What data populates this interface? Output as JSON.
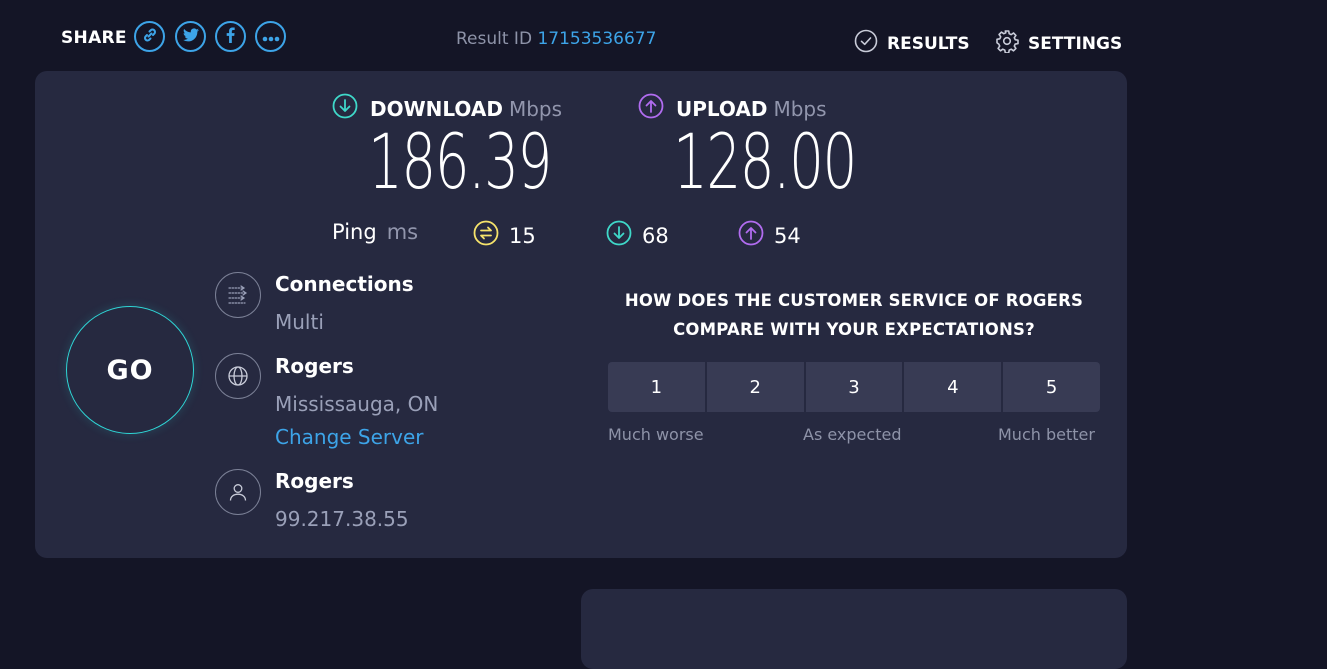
{
  "header": {
    "share_label": "SHARE",
    "share_icons": [
      "link-icon",
      "twitter-icon",
      "facebook-icon",
      "more-icon"
    ],
    "result_id_label": "Result ID",
    "result_id_value": "17153536677",
    "results_label": "RESULTS",
    "settings_label": "SETTINGS"
  },
  "download": {
    "label": "DOWNLOAD",
    "unit": "Mbps",
    "value": "186.39",
    "color": "#3fd8c9"
  },
  "upload": {
    "label": "UPLOAD",
    "unit": "Mbps",
    "value": "128.00",
    "color": "#b16cf0"
  },
  "ping": {
    "label": "Ping",
    "unit": "ms",
    "idle": "15",
    "download": "68",
    "upload": "54",
    "idle_color": "#f6e36b"
  },
  "go_label": "GO",
  "connections": {
    "title": "Connections",
    "value": "Multi"
  },
  "server": {
    "title": "Rogers",
    "location": "Mississauga, ON",
    "change_label": "Change Server"
  },
  "provider": {
    "title": "Rogers",
    "ip": "99.217.38.55"
  },
  "survey": {
    "question_line1": "HOW DOES THE CUSTOMER SERVICE OF ROGERS",
    "question_line2": "COMPARE WITH YOUR EXPECTATIONS?",
    "options": [
      "1",
      "2",
      "3",
      "4",
      "5"
    ],
    "low_label": "Much worse",
    "mid_label": "As expected",
    "high_label": "Much better"
  },
  "colors": {
    "background": "#141526",
    "panel": "#262940",
    "accent": "#3da4e8",
    "go_ring": "#2fd6d6"
  }
}
